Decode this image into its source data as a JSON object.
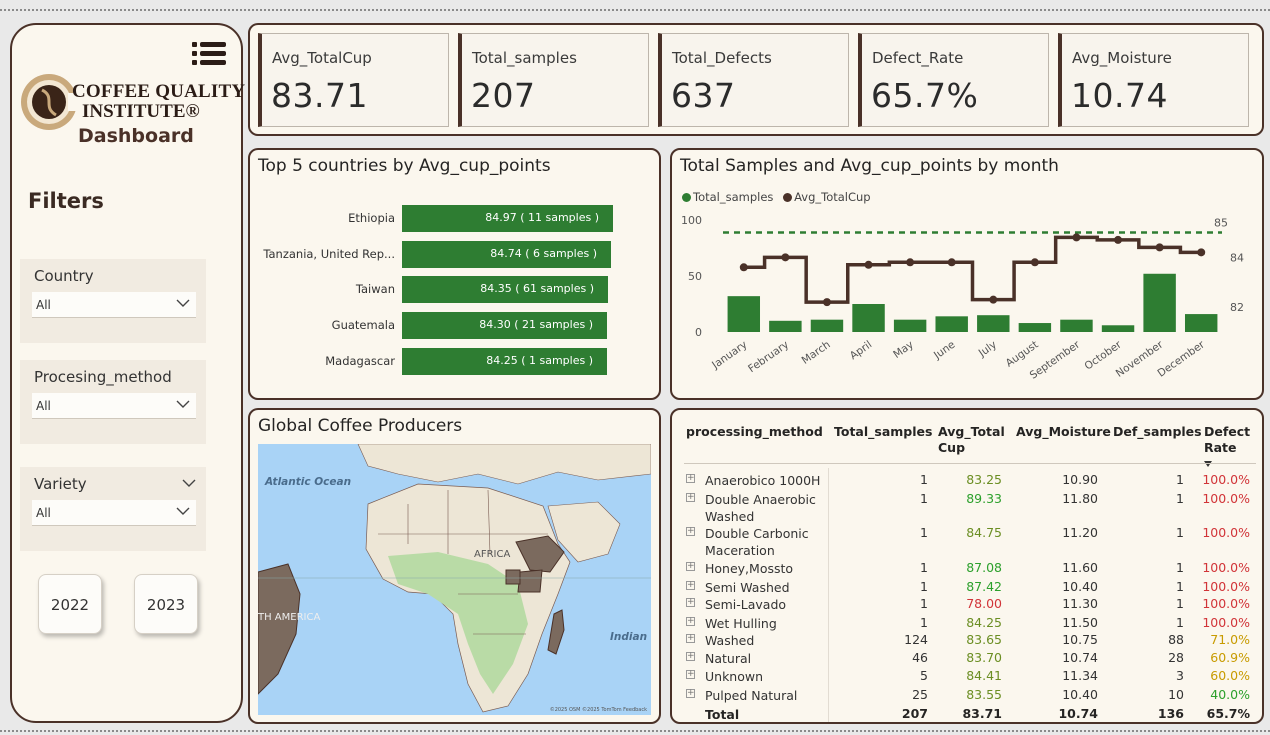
{
  "colors": {
    "brand_brown": "#4a3128",
    "bar_green": "#2e7d32",
    "panel_bg": "#fbf7ee",
    "red": "#d13438",
    "amber": "#c89b00",
    "green": "#2ca02c",
    "olive": "#6b8e23"
  },
  "sidebar": {
    "logo_line1": "COFFEE QUALITY",
    "logo_line2": "INSTITUTE®",
    "logo_line3": "Dashboard",
    "filters_title": "Filters",
    "slicers": [
      {
        "label": "Country",
        "value": "All"
      },
      {
        "label": "Procesing_method",
        "value": "All"
      },
      {
        "label": "Variety",
        "value": "All"
      }
    ],
    "years": [
      "2022",
      "2023"
    ]
  },
  "kpis": [
    {
      "label": "Avg_TotalCup",
      "value": "83.71"
    },
    {
      "label": "Total_samples",
      "value": "207"
    },
    {
      "label": "Total_Defects",
      "value": "637"
    },
    {
      "label": "Defect_Rate",
      "value": "65.7%"
    },
    {
      "label": "Avg_Moisture",
      "value": "10.74"
    }
  ],
  "top5": {
    "title": "Top 5 countries by Avg_cup_points",
    "rows": [
      {
        "country": "Ethiopia",
        "value": 84.97,
        "label": "84.97  ( 11 samples )"
      },
      {
        "country": "Tanzania, United Rep...",
        "value": 84.74,
        "label": "84.74  ( 6 samples )"
      },
      {
        "country": "Taiwan",
        "value": 84.35,
        "label": "84.35  ( 61 samples )"
      },
      {
        "country": "Guatemala",
        "value": 84.3,
        "label": "84.30  ( 21 samples )"
      },
      {
        "country": "Madagascar",
        "value": 84.25,
        "label": "84.25  ( 1 samples )"
      }
    ]
  },
  "chart_data": {
    "type": "bar",
    "title": "Total Samples and Avg_cup_points by month",
    "categories": [
      "January",
      "February",
      "March",
      "April",
      "May",
      "June",
      "July",
      "August",
      "September",
      "October",
      "November",
      "December"
    ],
    "series": [
      {
        "name": "Total_samples",
        "type": "bar",
        "axis": "left",
        "values": [
          32,
          10,
          11,
          25,
          11,
          14,
          15,
          8,
          11,
          6,
          52,
          16
        ]
      },
      {
        "name": "Avg_TotalCup",
        "type": "step-line",
        "axis": "right",
        "values": [
          83.6,
          84.0,
          82.2,
          83.7,
          83.8,
          83.8,
          82.3,
          83.8,
          84.8,
          84.7,
          84.4,
          84.2
        ]
      }
    ],
    "left_axis": {
      "ticks": [
        "100",
        "50",
        "0"
      ],
      "ylim": [
        0,
        100
      ]
    },
    "right_axis": {
      "ticks": [
        "84",
        "82"
      ],
      "ylim": [
        81,
        85.5
      ]
    },
    "reference_line": {
      "value": 85,
      "label": "85"
    },
    "legend": "top-left"
  },
  "map": {
    "title": "Global Coffee Producers",
    "labels": {
      "atlantic": "Atlantic Ocean",
      "africa": "AFRICA",
      "america": "TH AMERICA",
      "indian": "Indian",
      "credits": "©2025 OSM ©2025 TomTom Feedback"
    }
  },
  "table": {
    "headers": [
      "processing_method",
      "Total_samples",
      "Avg_Total Cup",
      "Avg_Moisture",
      "Def_samples",
      "Defect Rate"
    ],
    "rows": [
      {
        "method": "Anaerobico 1000H",
        "samples": "1",
        "cup": "83.25",
        "cup_color": "#6b8e23",
        "moist": "10.90",
        "def": "1",
        "rate": "100.0%",
        "rate_color": "#d13438"
      },
      {
        "method": "Double Anaerobic Washed",
        "samples": "1",
        "cup": "89.33",
        "cup_color": "#2ca02c",
        "moist": "11.80",
        "def": "1",
        "rate": "100.0%",
        "rate_color": "#d13438"
      },
      {
        "method": "Double Carbonic Maceration",
        "samples": "1",
        "cup": "84.75",
        "cup_color": "#6b8e23",
        "moist": "11.20",
        "def": "1",
        "rate": "100.0%",
        "rate_color": "#d13438"
      },
      {
        "method": "Honey,Mossto",
        "samples": "1",
        "cup": "87.08",
        "cup_color": "#2ca02c",
        "moist": "11.60",
        "def": "1",
        "rate": "100.0%",
        "rate_color": "#d13438"
      },
      {
        "method": "Semi Washed",
        "samples": "1",
        "cup": "87.42",
        "cup_color": "#2ca02c",
        "moist": "10.40",
        "def": "1",
        "rate": "100.0%",
        "rate_color": "#d13438"
      },
      {
        "method": "Semi-Lavado",
        "samples": "1",
        "cup": "78.00",
        "cup_color": "#d13438",
        "moist": "11.30",
        "def": "1",
        "rate": "100.0%",
        "rate_color": "#d13438"
      },
      {
        "method": "Wet Hulling",
        "samples": "1",
        "cup": "84.25",
        "cup_color": "#6b8e23",
        "moist": "11.50",
        "def": "1",
        "rate": "100.0%",
        "rate_color": "#d13438"
      },
      {
        "method": "Washed",
        "samples": "124",
        "cup": "83.65",
        "cup_color": "#6b8e23",
        "moist": "10.75",
        "def": "88",
        "rate": "71.0%",
        "rate_color": "#c89b00"
      },
      {
        "method": "Natural",
        "samples": "46",
        "cup": "83.70",
        "cup_color": "#6b8e23",
        "moist": "10.74",
        "def": "28",
        "rate": "60.9%",
        "rate_color": "#c89b00"
      },
      {
        "method": "Unknown",
        "samples": "5",
        "cup": "84.41",
        "cup_color": "#6b8e23",
        "moist": "11.34",
        "def": "3",
        "rate": "60.0%",
        "rate_color": "#c89b00"
      },
      {
        "method": "Pulped Natural",
        "samples": "25",
        "cup": "83.55",
        "cup_color": "#6b8e23",
        "moist": "10.40",
        "def": "10",
        "rate": "40.0%",
        "rate_color": "#2ca02c"
      }
    ],
    "total": {
      "method": "Total",
      "samples": "207",
      "cup": "83.71",
      "moist": "10.74",
      "def": "136",
      "rate": "65.7%"
    }
  }
}
